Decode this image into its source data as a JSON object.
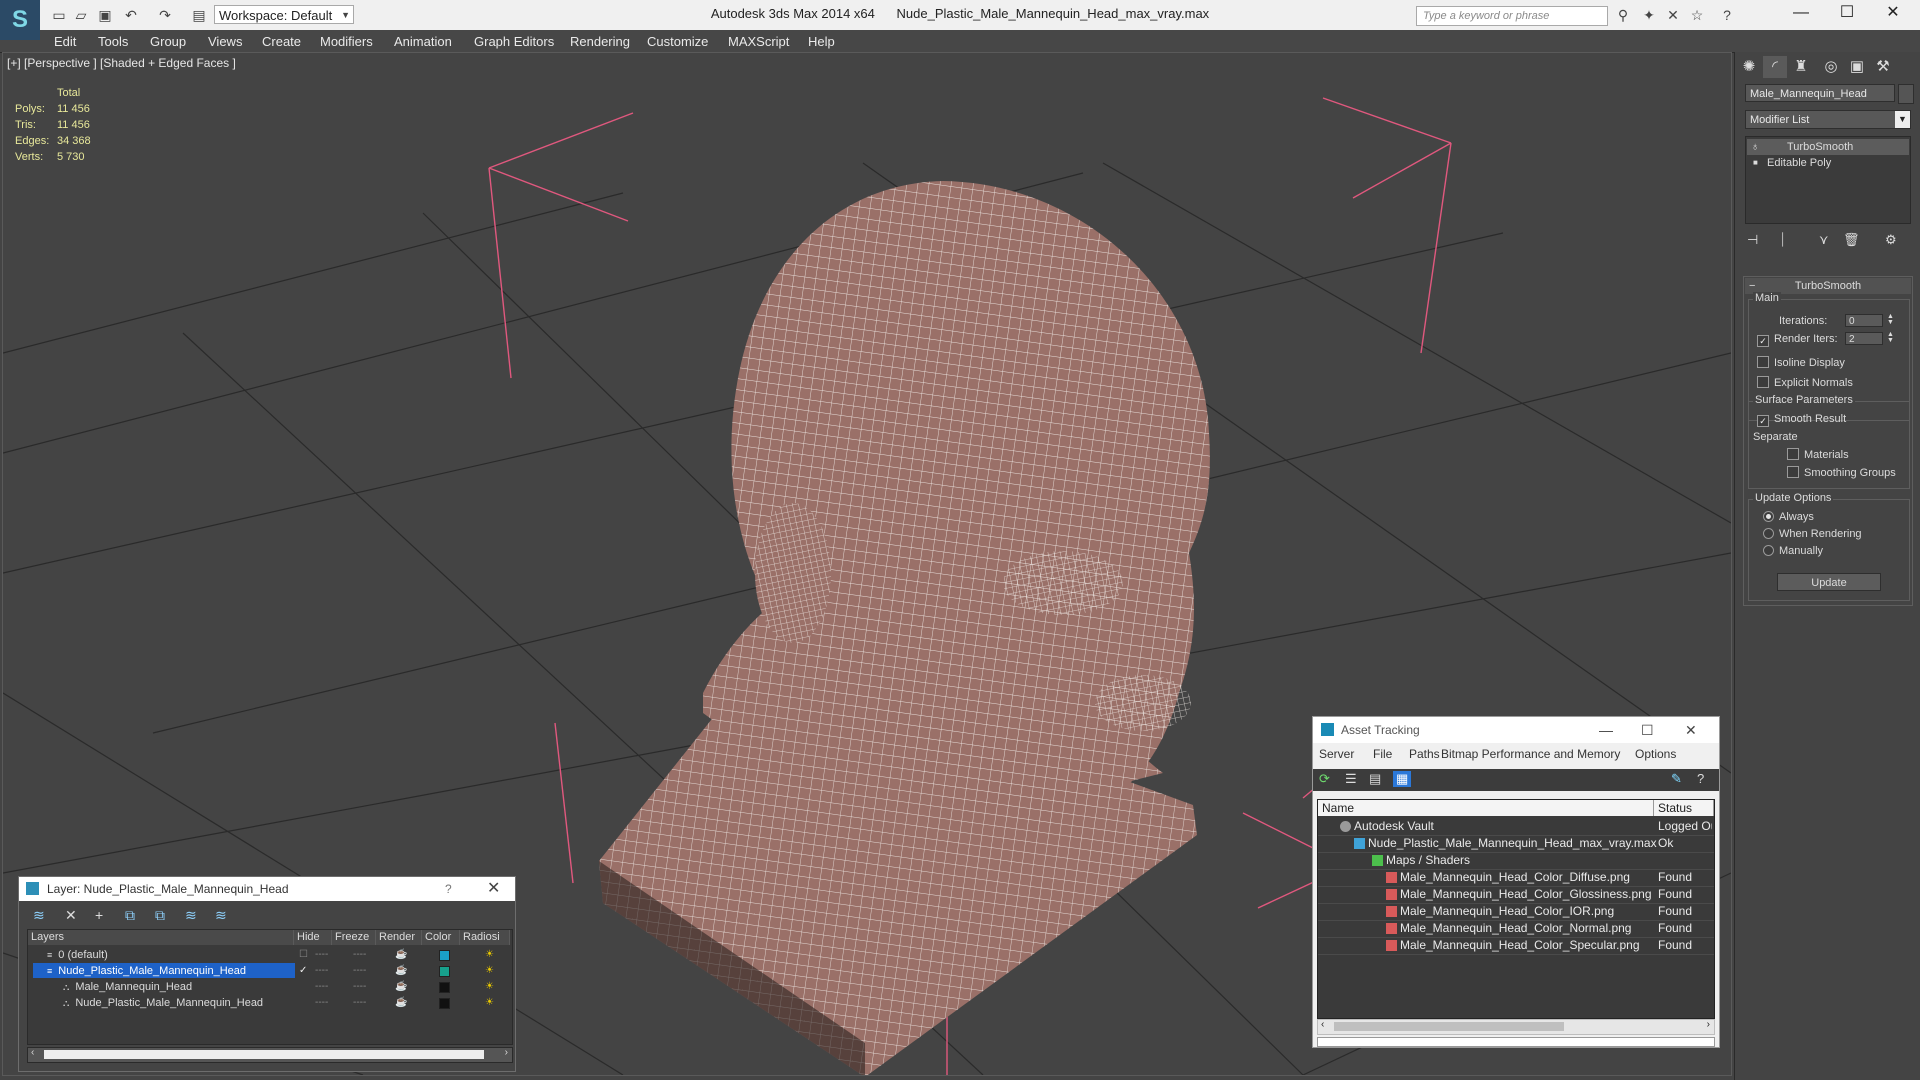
{
  "app": {
    "title": "Autodesk 3ds Max  2014 x64",
    "file": "Nude_Plastic_Male_Mannequin_Head_max_vray.max",
    "workspace": "Workspace: Default",
    "search_placeholder": "Type a keyword or phrase"
  },
  "menu": [
    "Edit",
    "Tools",
    "Group",
    "Views",
    "Create",
    "Modifiers",
    "Animation",
    "Graph Editors",
    "Rendering",
    "Customize",
    "MAXScript",
    "Help"
  ],
  "viewport": {
    "label": "[+] [Perspective ] [Shaded + Edged Faces ]",
    "stats_header": "Total",
    "stats": [
      {
        "label": "Polys:",
        "value": "11 456"
      },
      {
        "label": "Tris:",
        "value": "11 456"
      },
      {
        "label": "Edges:",
        "value": "34 368"
      },
      {
        "label": "Verts:",
        "value": "5 730"
      }
    ],
    "colors": {
      "grid": "#2a2a2a",
      "mesh": "#9a7068",
      "wire": "#f2ece8",
      "bbox": "#e0587e"
    }
  },
  "command_panel": {
    "object_name": "Male_Mannequin_Head",
    "modifier_list": "Modifier List",
    "stack": [
      "TurboSmooth",
      "Editable Poly"
    ],
    "rollout_title": "TurboSmooth",
    "main_label": "Main",
    "iterations_label": "Iterations:",
    "iterations_value": "0",
    "render_iters_label": "Render Iters:",
    "render_iters_value": "2",
    "isoline": "Isoline Display",
    "explicit_normals": "Explicit Normals",
    "surface_params": "Surface Parameters",
    "smooth_result": "Smooth Result",
    "separate": "Separate",
    "materials": "Materials",
    "smoothing_groups": "Smoothing Groups",
    "update_options": "Update Options",
    "always": "Always",
    "when_rendering": "When Rendering",
    "manually": "Manually",
    "update_button": "Update"
  },
  "layer_window": {
    "title": "Layer: Nude_Plastic_Male_Mannequin_Head",
    "columns": [
      "Layers",
      "Hide",
      "Freeze",
      "Render",
      "Color",
      "Radiosi"
    ],
    "rows": [
      {
        "name": "0 (default)",
        "color": "#1aa0c8"
      },
      {
        "name": "Nude_Plastic_Male_Mannequin_Head",
        "color": "#17a08c"
      },
      {
        "name": "Male_Mannequin_Head",
        "color": "#111111"
      },
      {
        "name": "Nude_Plastic_Male_Mannequin_Head",
        "color": "#111111"
      }
    ]
  },
  "asset_tracking": {
    "title": "Asset Tracking",
    "menu": [
      "Server",
      "File",
      "Paths",
      "Bitmap Performance and Memory",
      "Options"
    ],
    "columns": [
      "Name",
      "Status"
    ],
    "rows": [
      {
        "name": "Autodesk Vault",
        "status": "Logged Ou"
      },
      {
        "name": "Nude_Plastic_Male_Mannequin_Head_max_vray.max",
        "status": "Ok"
      },
      {
        "name": "Maps / Shaders",
        "status": ""
      },
      {
        "name": "Male_Mannequin_Head_Color_Diffuse.png",
        "status": "Found"
      },
      {
        "name": "Male_Mannequin_Head_Color_Glossiness.png",
        "status": "Found"
      },
      {
        "name": "Male_Mannequin_Head_Color_IOR.png",
        "status": "Found"
      },
      {
        "name": "Male_Mannequin_Head_Color_Normal.png",
        "status": "Found"
      },
      {
        "name": "Male_Mannequin_Head_Color_Specular.png",
        "status": "Found"
      }
    ]
  }
}
